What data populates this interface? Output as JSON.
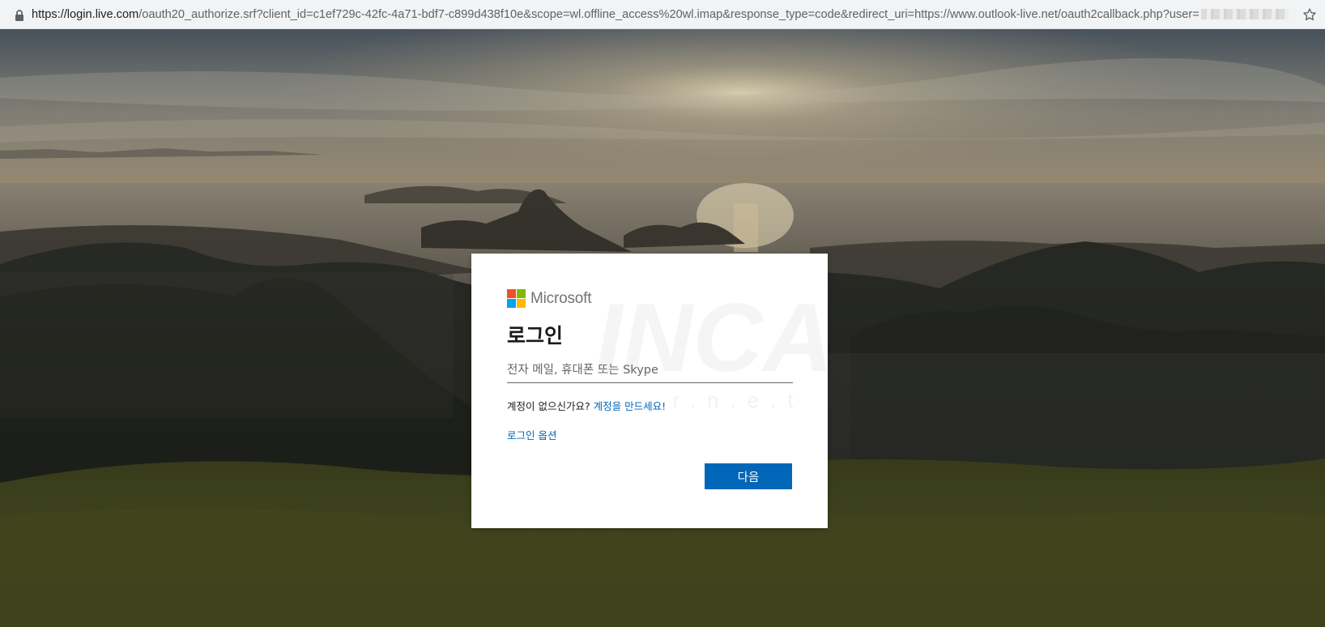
{
  "browser": {
    "url_host": "https://login.live.com",
    "url_rest": "/oauth20_authorize.srf?client_id=c1ef729c-42fc-4a71-bdf7-c899d438f10e&scope=wl.offline_access%20wl.imap&response_type=code&redirect_uri=https://www.outlook-live.net/oauth2callback.php?user=",
    "icons": {
      "lock": "lock-icon",
      "bookmark": "star-icon"
    }
  },
  "login": {
    "brand": "Microsoft",
    "title": "로그인",
    "email_placeholder": "전자 메일, 휴대폰 또는 Skype",
    "email_value": "",
    "no_account_text": "계정이 없으신가요?",
    "create_account_link": "계정을 만드세요!",
    "signin_options_link": "로그인 옵션",
    "next_button": "다음"
  },
  "colors": {
    "accent": "#0067b8",
    "logo_red": "#f25022",
    "logo_green": "#7fba00",
    "logo_blue": "#00a4ef",
    "logo_yellow": "#ffb900"
  }
}
